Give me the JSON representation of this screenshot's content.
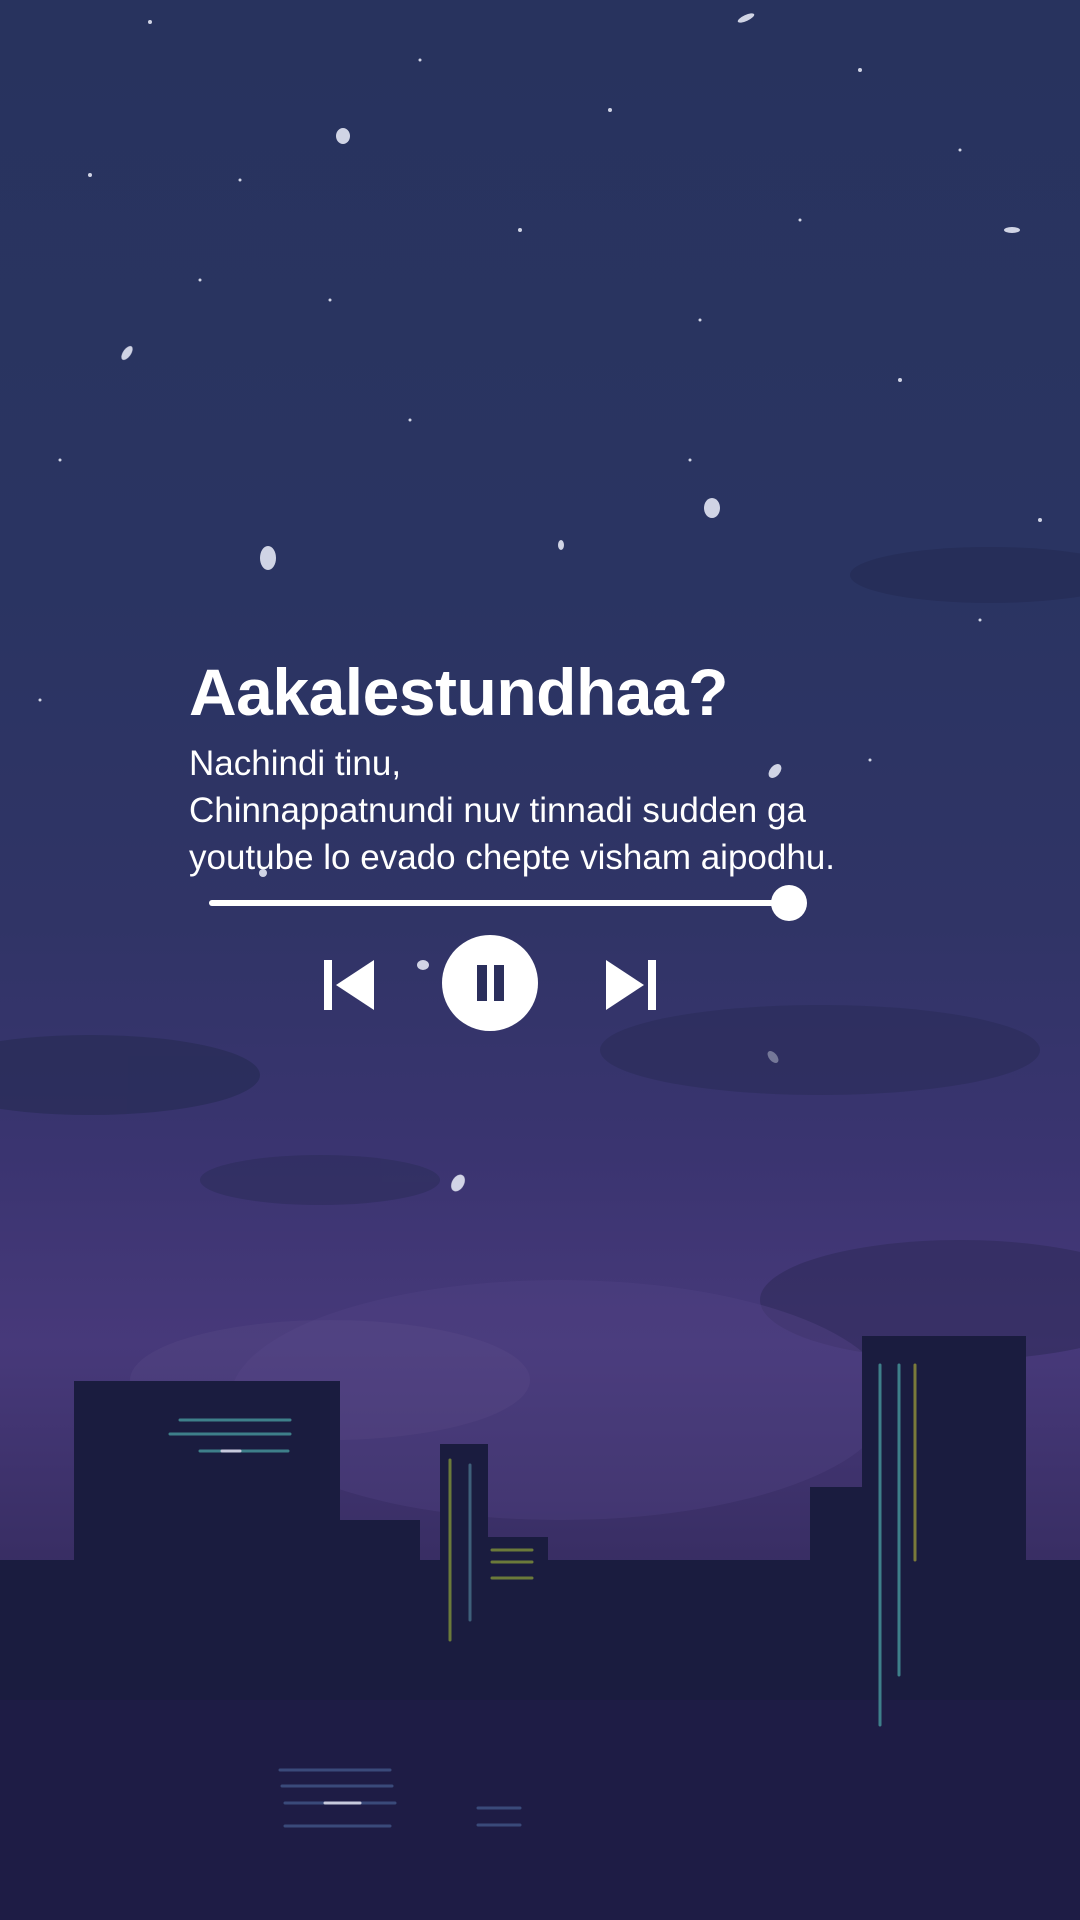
{
  "track": {
    "title": "Aakalestundhaa?",
    "lyrics": [
      "Nachindi tinu,",
      "Chinnappatnundi nuv tinnadi sudden ga",
      "youtube lo evado chepte visham aipodhu."
    ]
  },
  "player": {
    "progress": 0.97,
    "state": "playing",
    "controls": {
      "previous_icon": "skip-previous-icon",
      "pause_icon": "pause-icon",
      "next_icon": "skip-next-icon"
    }
  },
  "colors": {
    "sky_top": "#28335e",
    "sky_haze": "#47397a",
    "building": "#1a1c3f",
    "text": "#ffffff"
  }
}
